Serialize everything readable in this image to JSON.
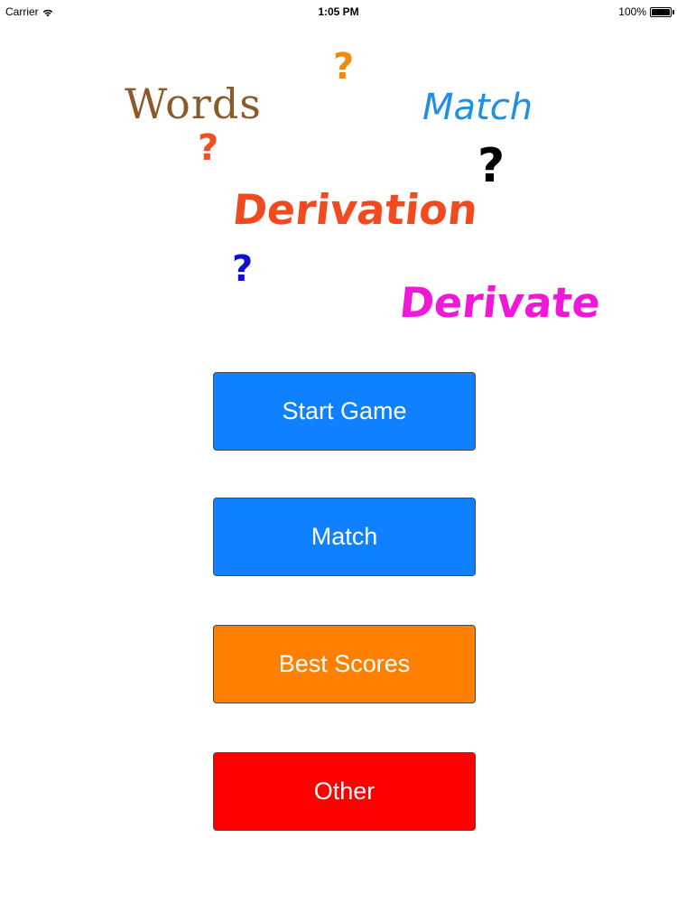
{
  "status_bar": {
    "carrier": "Carrier",
    "time": "1:05 PM",
    "battery": "100%",
    "wifi_icon": "wifi-icon",
    "battery_icon": "battery-icon"
  },
  "logo": {
    "words": [
      "Words",
      "Match",
      "Derivation",
      "Derivate"
    ],
    "question_mark": "?",
    "colors": {
      "words": "#8B5A2B",
      "match": "#1E8FE6",
      "derivation": "#F24A1E",
      "derivate": "#F018D8",
      "q_orange": "#F28A10",
      "q_red": "#F2501E",
      "q_black": "#000000",
      "q_blue": "#1010D0"
    }
  },
  "menu": {
    "start_game": "Start Game",
    "match": "Match",
    "best_scores": "Best Scores",
    "other": "Other",
    "colors": {
      "start_game": "#0F80FF",
      "match": "#0F80FF",
      "best_scores": "#FF8000",
      "other": "#FF0000"
    }
  }
}
